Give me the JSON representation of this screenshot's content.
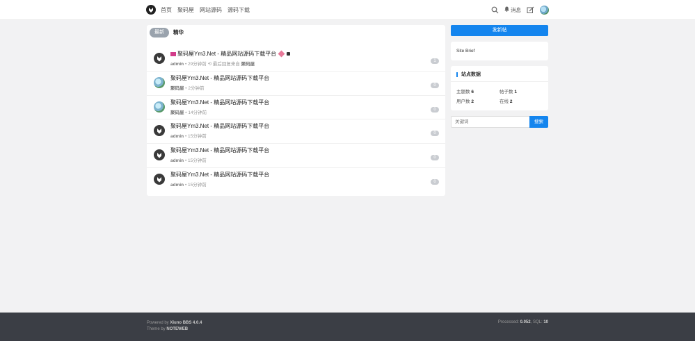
{
  "header": {
    "nav": [
      "首页",
      "聚码屋",
      "网站源码",
      "源码下载"
    ],
    "messages_label": "消息"
  },
  "main": {
    "tabs": [
      {
        "label": "最新",
        "active": true
      },
      {
        "label": "精华",
        "active": false
      }
    ],
    "threads": [
      {
        "title": "聚码屋Ym3.Net - 精品网站源码下载平台",
        "author": "admin",
        "time": "29分钟前",
        "extra_prefix": "最后回复来自",
        "extra_user": "聚码屋",
        "replies": "1",
        "avatar": "dark",
        "flag": true
      },
      {
        "title": "聚码屋Ym3.Net - 精品网站源码下载平台",
        "author": "聚码屋",
        "time": "2分钟前",
        "replies": "0",
        "avatar": "photo"
      },
      {
        "title": "聚码屋Ym3.Net - 精品网站源码下载平台",
        "author": "聚码屋",
        "time": "14分钟前",
        "replies": "0",
        "avatar": "photo"
      },
      {
        "title": "聚码屋Ym3.Net - 精品网站源码下载平台",
        "author": "admin",
        "time": "15分钟前",
        "replies": "0",
        "avatar": "dark"
      },
      {
        "title": "聚码屋Ym3.Net - 精品网站源码下载平台",
        "author": "admin",
        "time": "15分钟前",
        "replies": "0",
        "avatar": "dark"
      },
      {
        "title": "聚码屋Ym3.Net - 精品网站源码下载平台",
        "author": "admin",
        "time": "15分钟前",
        "replies": "0",
        "avatar": "dark"
      }
    ]
  },
  "sidebar": {
    "new_post": "发新帖",
    "brief": "Site Brief",
    "stats_title": "站点数据",
    "stats": {
      "threads_label": "主题数",
      "threads": "6",
      "posts_label": "帖子数",
      "posts": "1",
      "users_label": "用户数",
      "users": "2",
      "online_label": "在线",
      "online": "2"
    },
    "search_placeholder": "关键词",
    "search_button": "搜索"
  },
  "footer": {
    "powered_prefix": "Powered by",
    "powered_name": "Xiuno BBS 4.0.4",
    "theme_prefix": "Theme by",
    "theme_name": "NOTEWEB",
    "processed_label": "Processed:",
    "processed": "0.052",
    "sql_label": "SQL:",
    "sql": "10"
  },
  "colors": {
    "accent": "#1485ee",
    "footer_bg": "#3b3e45",
    "page_bg": "#f2f2f3"
  }
}
